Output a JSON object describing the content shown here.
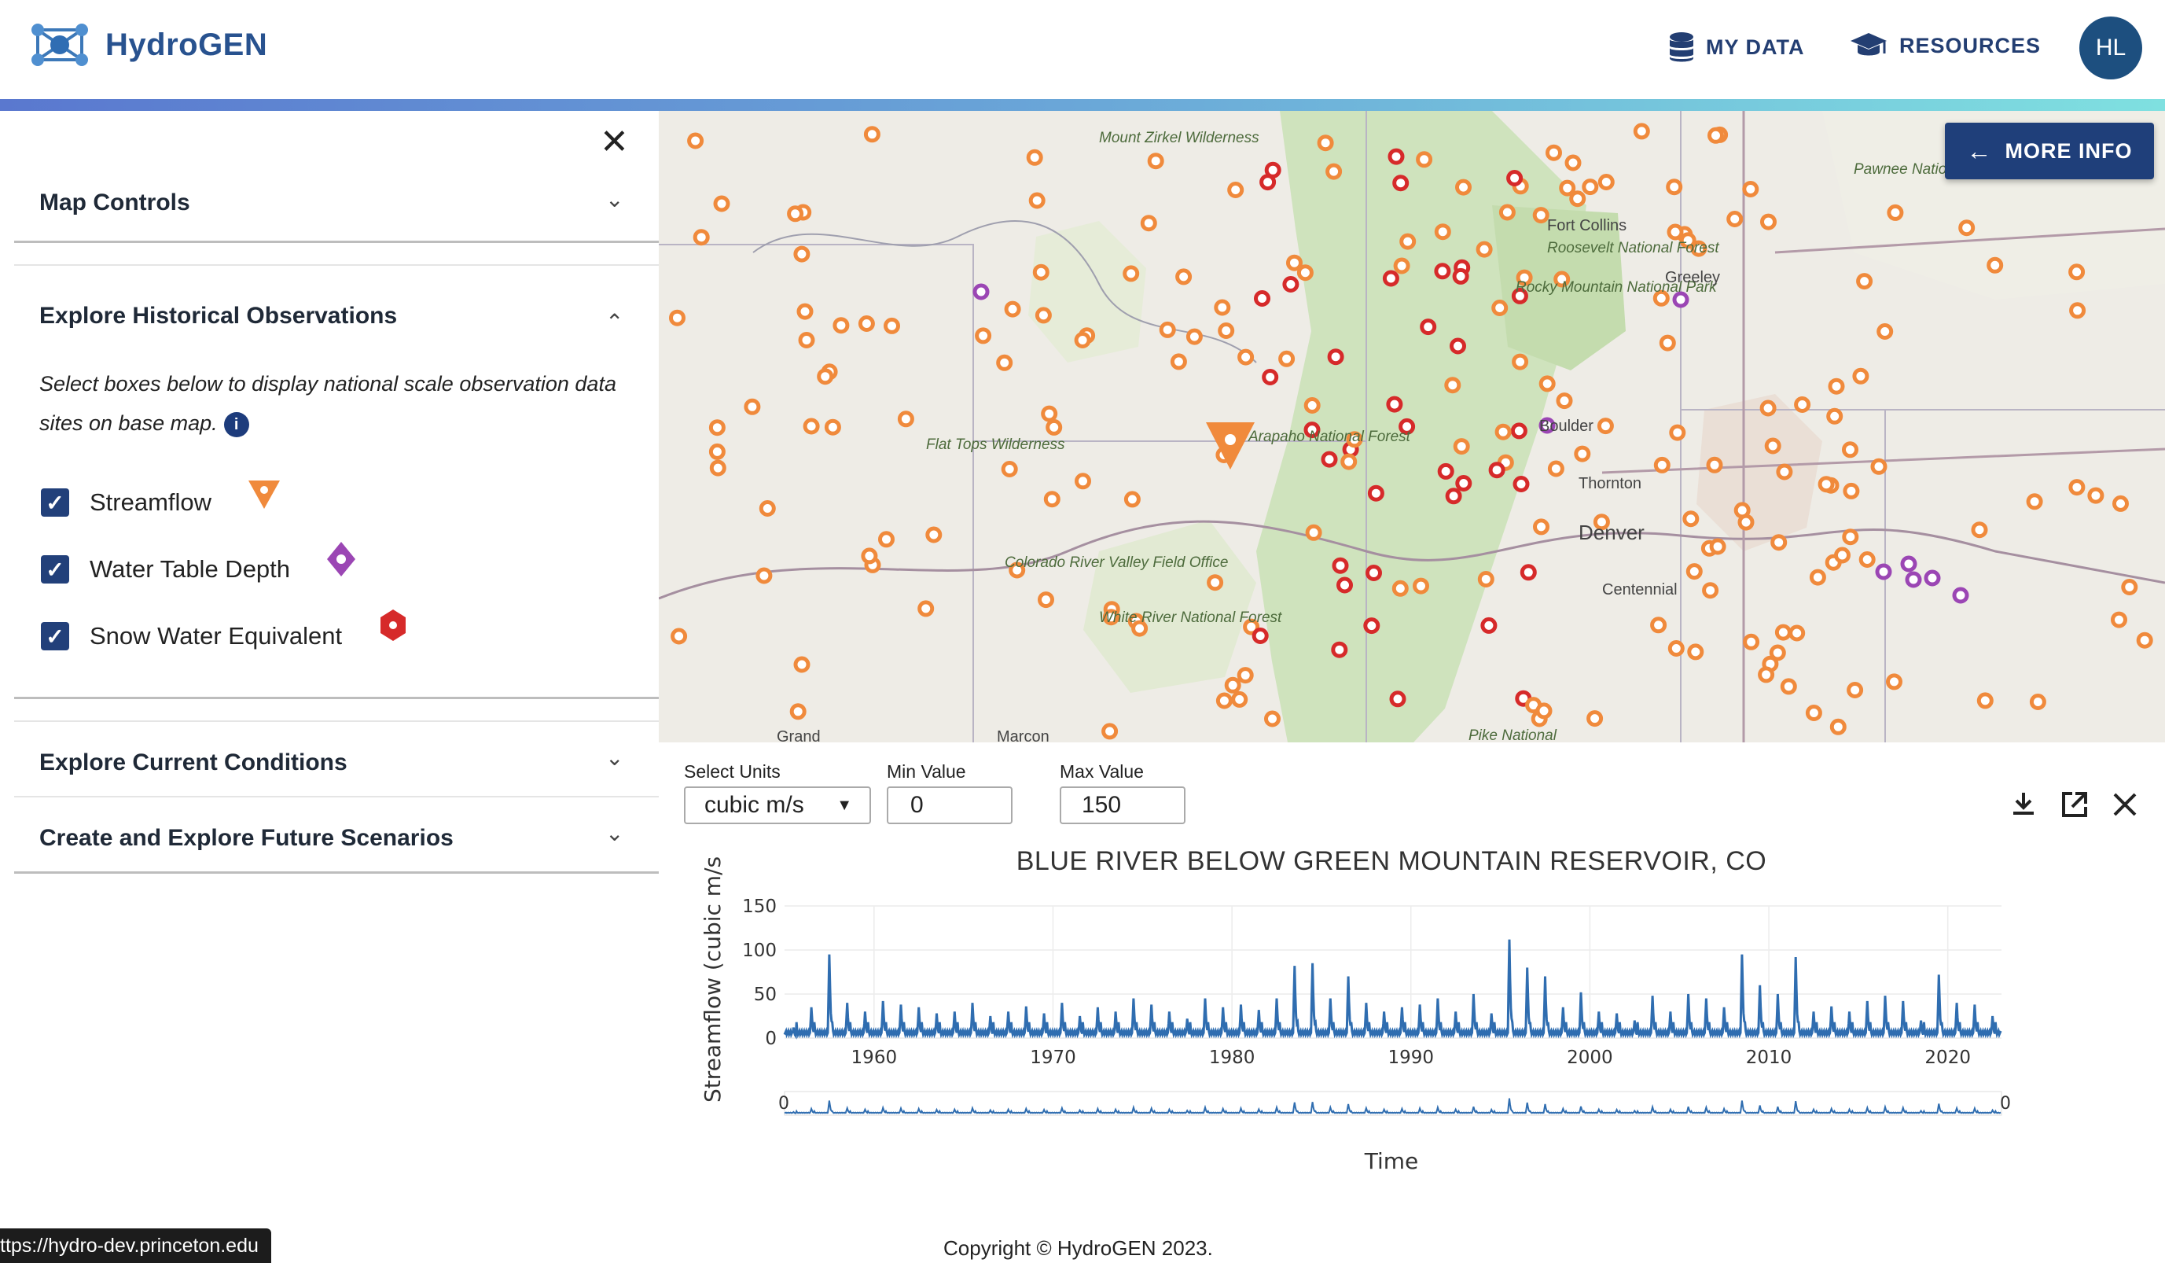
{
  "header": {
    "brand": "HydroGEN",
    "nav": [
      {
        "label": "MY DATA",
        "icon": "database-icon"
      },
      {
        "label": "RESOURCES",
        "icon": "graduation-cap-icon"
      }
    ],
    "avatar_initials": "HL"
  },
  "sidebar": {
    "map_controls": "Map Controls",
    "historical": {
      "title": "Explore Historical Observations",
      "description": "Select boxes below to display national scale observation data sites on base map.",
      "layers": [
        {
          "label": "Streamflow",
          "checked": true,
          "marker": "triangle",
          "color": "#f08a3c"
        },
        {
          "label": "Water Table Depth",
          "checked": true,
          "marker": "diamond",
          "color": "#9b46b4"
        },
        {
          "label": "Snow Water Equivalent",
          "checked": true,
          "marker": "hexagon",
          "color": "#d62a2a"
        }
      ]
    },
    "current": "Explore Current Conditions",
    "future": "Create and Explore Future Scenarios"
  },
  "map": {
    "more_info": "MORE INFO",
    "place_labels": [
      "Mount Zirkel Wilderness",
      "Pawnee National Grassland",
      "Fort Collins",
      "Roosevelt National Forest",
      "Rocky Mountain National Park",
      "Greeley",
      "Flat Tops Wilderness",
      "Arapaho National Forest",
      "Boulder",
      "Thornton",
      "Denver",
      "Colorado River Valley Field Office",
      "White River National Forest",
      "Centennial",
      "Pike National",
      "Grand",
      "Marcon"
    ]
  },
  "chart_panel": {
    "units_label": "Select Units",
    "units_value": "cubic m/s",
    "min_label": "Min Value",
    "min_value": "0",
    "max_label": "Max Value",
    "max_value": "150"
  },
  "chart_data": {
    "type": "line",
    "title": "BLUE RIVER BELOW GREEN MOUNTAIN RESERVOIR, CO",
    "xlabel": "Time",
    "ylabel": "Streamflow (cubic m/s)",
    "ylim": [
      0,
      150
    ],
    "yticks": [
      0,
      50,
      100,
      150
    ],
    "xlim": [
      1955,
      2023
    ],
    "xticks": [
      1960,
      1970,
      1980,
      1990,
      2000,
      2010,
      2020
    ],
    "annual_peaks": {
      "years": [
        1955,
        1956,
        1957,
        1958,
        1959,
        1960,
        1961,
        1962,
        1963,
        1964,
        1965,
        1966,
        1967,
        1968,
        1969,
        1970,
        1971,
        1972,
        1973,
        1974,
        1975,
        1976,
        1977,
        1978,
        1979,
        1980,
        1981,
        1982,
        1983,
        1984,
        1985,
        1986,
        1987,
        1988,
        1989,
        1990,
        1991,
        1992,
        1993,
        1994,
        1995,
        1996,
        1997,
        1998,
        1999,
        2000,
        2001,
        2002,
        2003,
        2004,
        2005,
        2006,
        2007,
        2008,
        2009,
        2010,
        2011,
        2012,
        2013,
        2014,
        2015,
        2016,
        2017,
        2018,
        2019,
        2020,
        2021,
        2022
      ],
      "values": [
        12,
        35,
        95,
        40,
        30,
        42,
        38,
        35,
        28,
        30,
        40,
        25,
        30,
        36,
        28,
        40,
        25,
        35,
        30,
        45,
        38,
        30,
        22,
        45,
        35,
        38,
        32,
        45,
        82,
        85,
        45,
        70,
        40,
        30,
        35,
        38,
        45,
        30,
        50,
        28,
        112,
        80,
        70,
        35,
        52,
        30,
        28,
        20,
        48,
        30,
        50,
        45,
        35,
        95,
        60,
        50,
        92,
        30,
        36,
        30,
        42,
        48,
        42,
        20,
        72,
        40,
        38,
        25
      ]
    },
    "range_slider": {
      "min_label": "0",
      "max_label": "0"
    }
  },
  "footer": {
    "copyright": "Copyright © HydroGEN 2023.",
    "status_url": "ttps://hydro-dev.princeton.edu"
  }
}
